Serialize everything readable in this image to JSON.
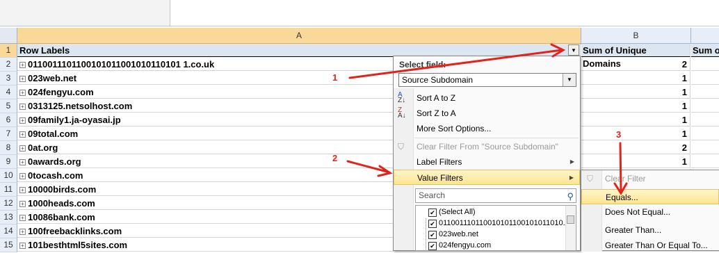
{
  "columns": {
    "a": "A",
    "b": "B"
  },
  "header_row": {
    "row_num": "1",
    "label": "Row Labels",
    "b": "Sum of Unique Domains",
    "c": "Sum of"
  },
  "rows": [
    {
      "num": "2",
      "label": "0110011101100101011001010110101 1.co.uk",
      "value": "2"
    },
    {
      "num": "3",
      "label": "023web.net",
      "value": "1"
    },
    {
      "num": "4",
      "label": "024fengyu.com",
      "value": "1"
    },
    {
      "num": "5",
      "label": "0313125.netsolhost.com",
      "value": "1"
    },
    {
      "num": "6",
      "label": "09family1.ja-oyasai.jp",
      "value": "1"
    },
    {
      "num": "7",
      "label": "09total.com",
      "value": "1"
    },
    {
      "num": "8",
      "label": "0at.org",
      "value": "2"
    },
    {
      "num": "9",
      "label": "0awards.org",
      "value": "1"
    },
    {
      "num": "10",
      "label": "0tocash.com",
      "value": ""
    },
    {
      "num": "11",
      "label": "10000birds.com",
      "value": ""
    },
    {
      "num": "12",
      "label": "1000heads.com",
      "value": ""
    },
    {
      "num": "13",
      "label": "10086bank.com",
      "value": ""
    },
    {
      "num": "14",
      "label": "100freebacklinks.com",
      "value": ""
    },
    {
      "num": "15",
      "label": "101besthtml5sites.com",
      "value": ""
    }
  ],
  "filter_menu": {
    "title": "Select field:",
    "field_value": "Source Subdomain",
    "sort_az": "Sort A to Z",
    "sort_za": "Sort Z to A",
    "more_sort": "More Sort Options...",
    "clear_filter": "Clear Filter From \"Source Subdomain\"",
    "label_filters": "Label Filters",
    "value_filters": "Value Filters",
    "search_placeholder": "Search",
    "list": [
      "(Select All)",
      "011001110110010101100101011010...",
      "023web.net",
      "024fengyu.com"
    ]
  },
  "submenu": {
    "clear_filter": "Clear Filter",
    "equals": "Equals...",
    "not_equal": "Does Not Equal...",
    "greater": "Greater Than...",
    "greater_equal": "Greater Than Or Equal To..."
  },
  "annotations": {
    "one": "1",
    "two": "2",
    "three": "3"
  },
  "colors": {
    "arrow": "#e2231a",
    "highlight": "#fde58f",
    "selected_header": "#f9d99a"
  }
}
